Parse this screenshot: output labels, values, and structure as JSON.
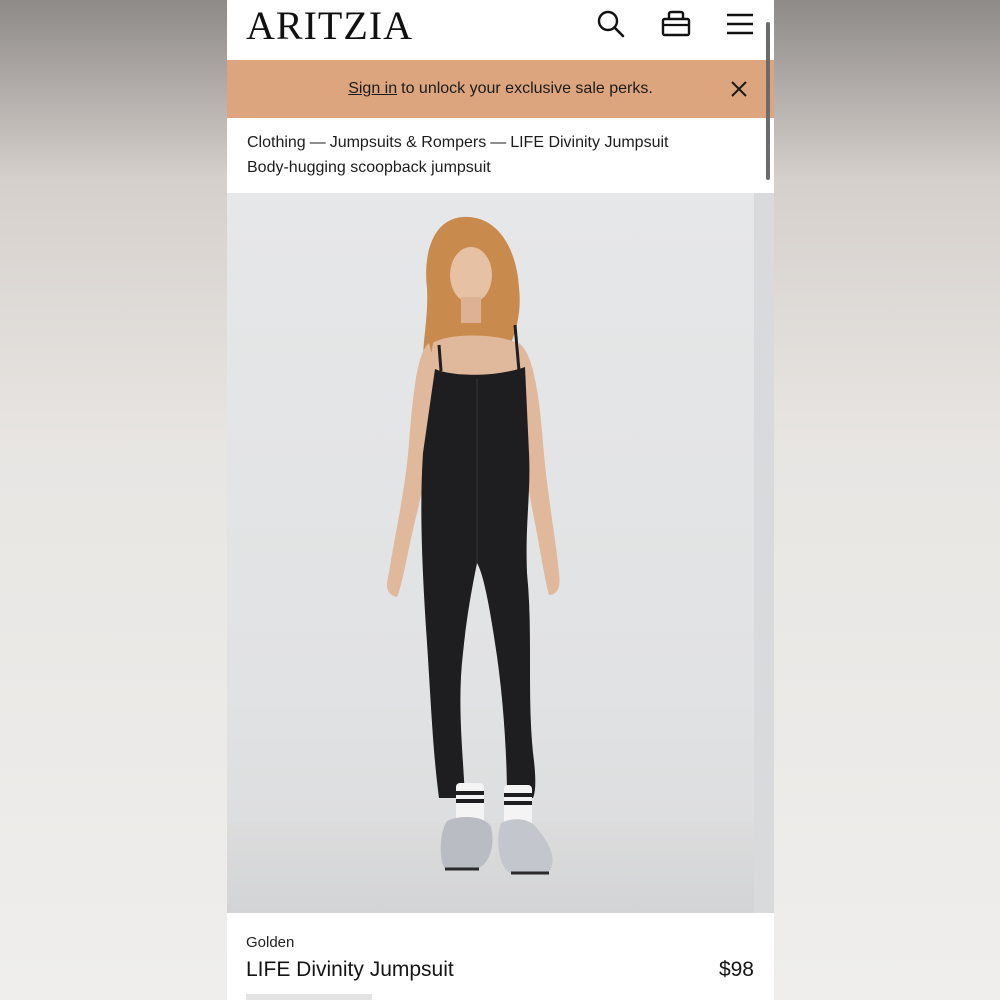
{
  "header": {
    "logo": "ARITZIA",
    "icons": [
      "search-icon",
      "shopping-bag-icon",
      "menu-icon"
    ]
  },
  "banner": {
    "sign_in_label": "Sign in",
    "message": "to unlock your exclusive sale perks.",
    "background": "#dca57d"
  },
  "breadcrumb": {
    "items": [
      "Clothing",
      "Jumpsuits & Rompers",
      "LIFE Divinity Jumpsuit"
    ],
    "separator": "—",
    "subtitle": "Body-hugging scoopback jumpsuit"
  },
  "product": {
    "brand": "Golden",
    "name": "LIFE Divinity Jumpsuit",
    "price": "$98",
    "image": "model wearing black sleeveless jumpsuit with white striped socks and silver sneakers"
  }
}
